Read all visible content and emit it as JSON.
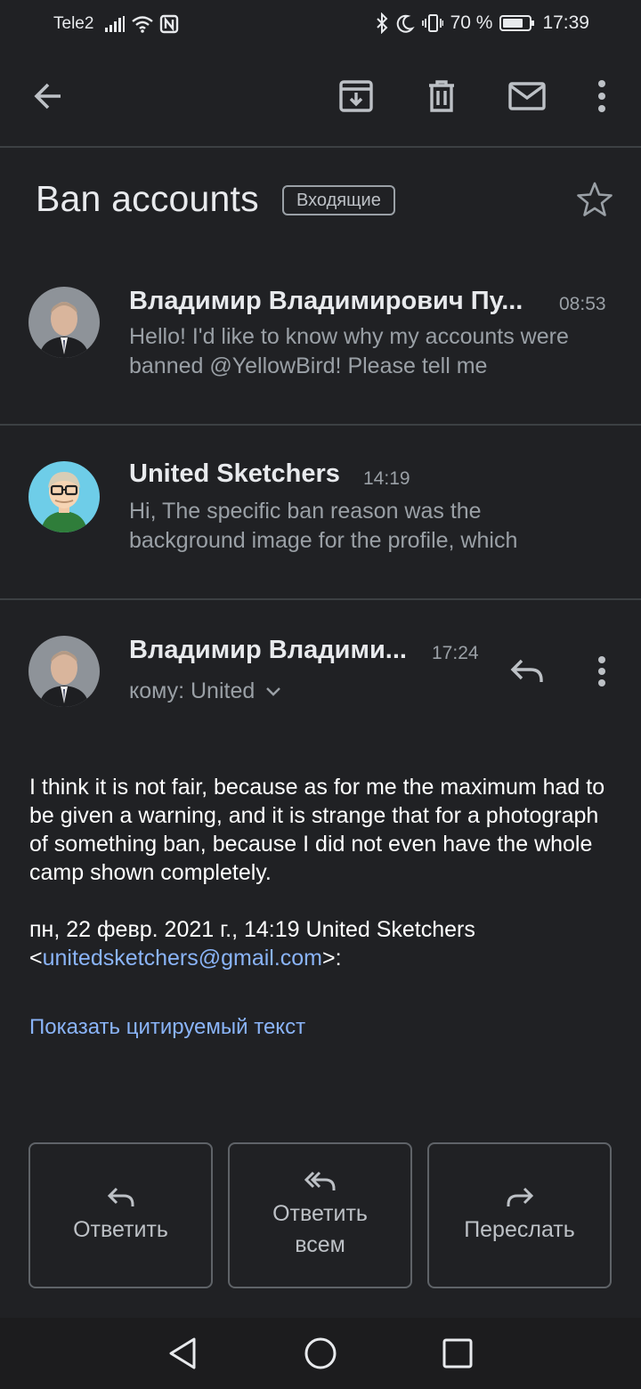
{
  "status_bar": {
    "carrier": "Tele2",
    "battery": "70 %",
    "time": "17:39"
  },
  "toolbar": {
    "back_icon": "arrow-back-icon",
    "archive_icon": "archive-icon",
    "delete_icon": "trash-icon",
    "unread_icon": "mail-icon",
    "more_icon": "more-vert-icon"
  },
  "thread": {
    "subject": "Ban accounts",
    "label": "Входящие"
  },
  "messages": [
    {
      "sender": "Владимир Владимирович Пу...",
      "time": "08:53",
      "snippet": "Hello! I'd like to know why my accounts were banned @YellowBird! Please tell me"
    },
    {
      "sender": "United Sketchers",
      "time": "14:19",
      "snippet": "Hi, The specific ban reason was the background image for the profile, which"
    }
  ],
  "open_message": {
    "sender": "Владимир Владими...",
    "time": "17:24",
    "to": "кому: United",
    "body": "I think it is not fair, because as for me the maximum had to be given a warning, and it is strange that for a photograph of something ban, because I did not even have the whole camp shown completely.",
    "quote_prefix": "пн, 22 февр. 2021 г., 14:19 United Sketchers",
    "quote_email_open": "<",
    "quote_email": "unitedsketchers@gmail.com",
    "quote_email_close": ">:",
    "show_quoted": "Показать цитируемый текст"
  },
  "actions": {
    "reply": "Ответить",
    "reply_all": "Ответить всем",
    "forward": "Переслать"
  },
  "colors": {
    "background": "#202124",
    "link": "#8ab4f8",
    "secondary_text": "#9aa0a6"
  }
}
